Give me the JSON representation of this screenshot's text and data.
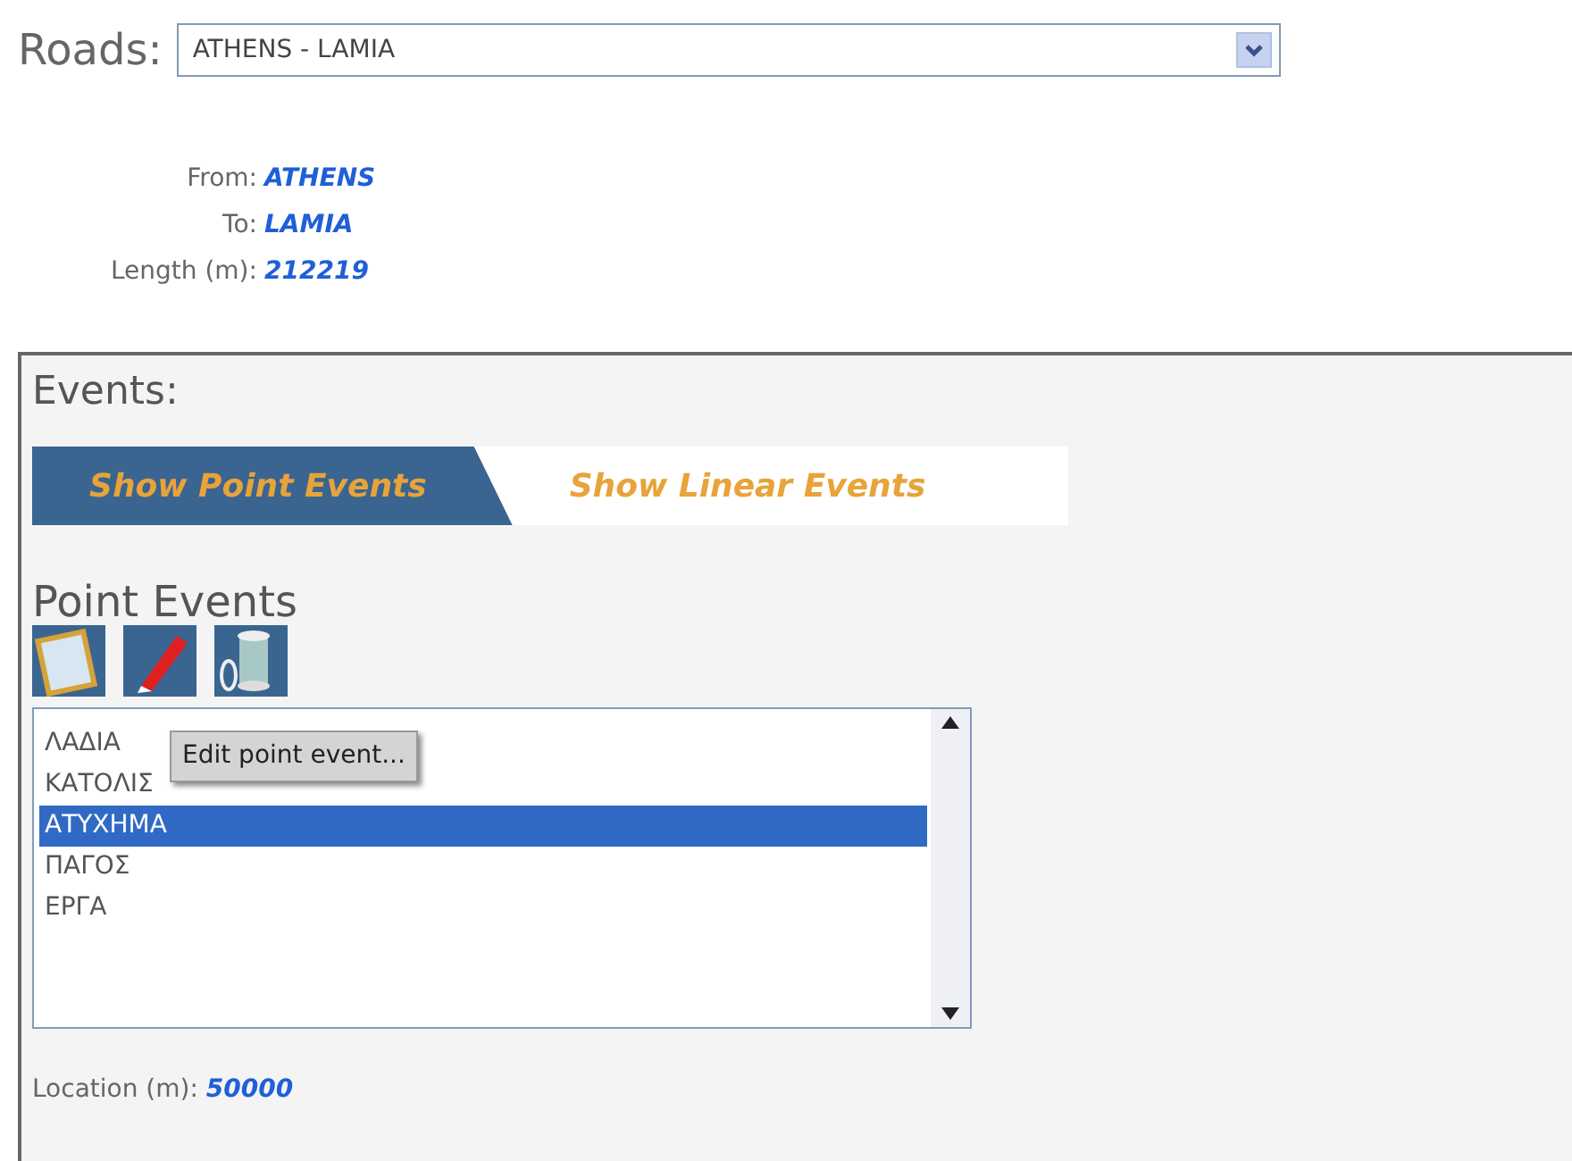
{
  "roads": {
    "label": "Roads:",
    "value": "ATHENS - LAMIA"
  },
  "info": [
    {
      "label": "From:",
      "value": "ATHENS"
    },
    {
      "label": "To:",
      "value": "LAMIA"
    },
    {
      "label": "Length (m):",
      "value": "212219"
    }
  ],
  "events": {
    "title": "Events:",
    "tabs": [
      {
        "label": "Show Point Events",
        "selected": true
      },
      {
        "label": "Show Linear Events",
        "selected": false
      }
    ],
    "section_title": "Point Events",
    "toolbar": [
      {
        "kind": "note"
      },
      {
        "kind": "edit"
      },
      {
        "kind": "spool"
      }
    ],
    "list": [
      {
        "label": "ΛΑΔΙΑ",
        "selected": false
      },
      {
        "label": "ΚΑΤΟΛΙΣ",
        "selected": false
      },
      {
        "label": "ΑΤΥΧΗΜΑ",
        "selected": true
      },
      {
        "label": "ΠΑΓΟΣ",
        "selected": false
      },
      {
        "label": "ΕΡΓΑ",
        "selected": false
      }
    ],
    "tooltip": "Edit point event...",
    "location": {
      "label": "Location (m):",
      "value": "50000"
    }
  }
}
